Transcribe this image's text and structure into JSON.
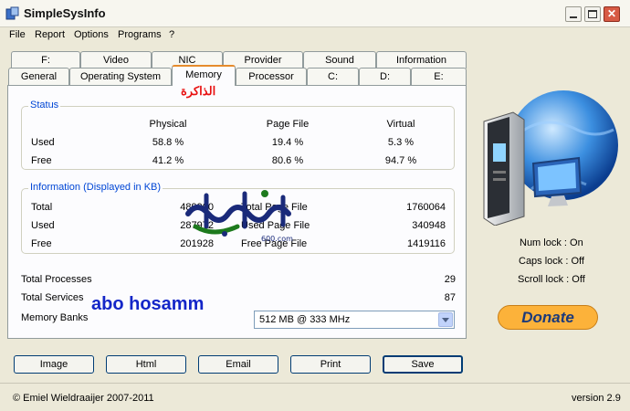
{
  "window": {
    "title": "SimpleSysInfo",
    "minimize_icon": "minimize-icon",
    "maximize_icon": "maximize-icon",
    "close_icon": "close-icon"
  },
  "menu": [
    "File",
    "Report",
    "Options",
    "Programs",
    "?"
  ],
  "tabs_row1": [
    "F:",
    "Video",
    "NIC",
    "Provider",
    "Sound",
    "Information"
  ],
  "tabs_row2": [
    "General",
    "Operating System",
    "Memory",
    "Processor",
    "C:",
    "D:",
    "E:"
  ],
  "active_tab": "Memory",
  "overlay": {
    "arabic_memory": "الذاكرة",
    "watermark": "abo hosamm",
    "logo_icon": "site-logo-arabic-text"
  },
  "status": {
    "title": "Status",
    "headers": [
      "Physical",
      "Page File",
      "Virtual"
    ],
    "rows": [
      {
        "label": "Used",
        "values": [
          "58.8 %",
          "19.4 %",
          "5.3 %"
        ]
      },
      {
        "label": "Free",
        "values": [
          "41.2 %",
          "80.6 %",
          "94.7 %"
        ]
      }
    ]
  },
  "info": {
    "title": "Information (Displayed in KB)",
    "rows": [
      {
        "label": "Total",
        "v1": "489900",
        "label2": "Total Page File",
        "v2": "1760064"
      },
      {
        "label": "Used",
        "v1": "287972",
        "label2": "Used Page File",
        "v2": "340948"
      },
      {
        "label": "Free",
        "v1": "201928",
        "label2": "Free Page File",
        "v2": "1419116"
      }
    ]
  },
  "summary": {
    "processes_label": "Total Processes",
    "processes_value": "29",
    "services_label": "Total Services",
    "services_value": "87",
    "banks_label": "Memory Banks",
    "banks_value": "512 MB @ 333 MHz"
  },
  "side": {
    "computer_icon": "computer-globe-icon",
    "num_lock": "Num lock : On",
    "caps_lock": "Caps lock : Off",
    "scroll_lock": "Scroll lock : Off",
    "donate": "Donate"
  },
  "buttons": [
    "Image",
    "Html",
    "Email",
    "Print",
    "Save"
  ],
  "footer": {
    "copyright": "© Emiel Wieldraaijer 2007-2011",
    "version": "version 2.9"
  },
  "colors": {
    "accent_orange": "#e68b2c",
    "group_title_blue": "#0046d5",
    "overlay_red": "#e81010",
    "overlay_blue": "#1426c8",
    "donate": "#fcb23a"
  }
}
